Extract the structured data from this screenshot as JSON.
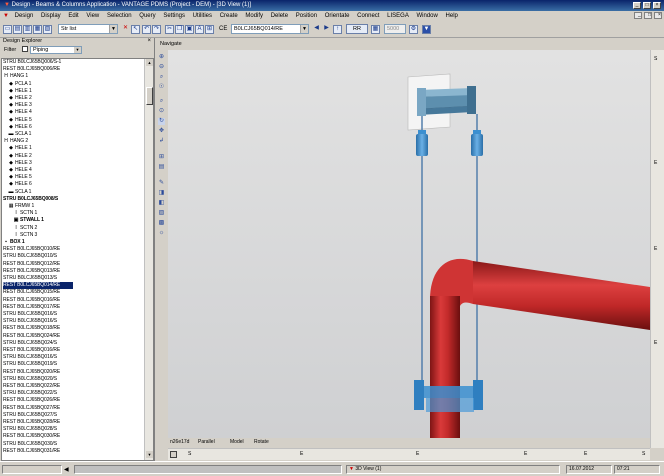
{
  "window": {
    "title": "Design - Beams & Columns Application - VANTAGE PDMS (Project - DEM) - [3D View (1)]"
  },
  "menu": {
    "items": [
      "Design",
      "Display",
      "Edit",
      "View",
      "Selection",
      "Query",
      "Settings",
      "Utilities",
      "Create",
      "Modify",
      "Delete",
      "Position",
      "Orientate",
      "Connect",
      "LISEGA",
      "Window",
      "Help"
    ]
  },
  "toolbar": {
    "element_field": "Str list",
    "ce_label": "CE",
    "ce_value": "B0LCJ65BQ014/RE",
    "rr_button": "RR",
    "zoom_field": "5000"
  },
  "explorer": {
    "title": "Design Explorer",
    "close_glyph": "×",
    "filter_label": "Filter",
    "filter_value": "Piping",
    "tree": [
      {
        "text": "STRU B0LCJ65BQ006/S-1",
        "icon": "",
        "indent": 0,
        "bold": false,
        "selected": false
      },
      {
        "text": "REST B0LCJ65BQ006/RE",
        "icon": "",
        "indent": 0,
        "bold": false,
        "selected": false
      },
      {
        "text": "HANG 1",
        "icon": "H",
        "indent": 0,
        "bold": false,
        "selected": false
      },
      {
        "text": "PCLA 1",
        "icon": "◆",
        "indent": 1,
        "bold": false,
        "selected": false
      },
      {
        "text": "HELE 1",
        "icon": "◆",
        "indent": 1,
        "bold": false,
        "selected": false
      },
      {
        "text": "HELE 2",
        "icon": "◆",
        "indent": 1,
        "bold": false,
        "selected": false
      },
      {
        "text": "HELE 3",
        "icon": "◆",
        "indent": 1,
        "bold": false,
        "selected": false
      },
      {
        "text": "HELE 4",
        "icon": "◆",
        "indent": 1,
        "bold": false,
        "selected": false
      },
      {
        "text": "HELE 5",
        "icon": "◆",
        "indent": 1,
        "bold": false,
        "selected": false
      },
      {
        "text": "HELE 6",
        "icon": "◆",
        "indent": 1,
        "bold": false,
        "selected": false
      },
      {
        "text": "SCLA 1",
        "icon": "▬",
        "indent": 1,
        "bold": false,
        "selected": false
      },
      {
        "text": "HANG 2",
        "icon": "H",
        "indent": 0,
        "bold": false,
        "selected": false
      },
      {
        "text": "HELE 1",
        "icon": "◆",
        "indent": 1,
        "bold": false,
        "selected": false
      },
      {
        "text": "HELE 2",
        "icon": "◆",
        "indent": 1,
        "bold": false,
        "selected": false
      },
      {
        "text": "HELE 3",
        "icon": "◆",
        "indent": 1,
        "bold": false,
        "selected": false
      },
      {
        "text": "HELE 4",
        "icon": "◆",
        "indent": 1,
        "bold": false,
        "selected": false
      },
      {
        "text": "HELE 5",
        "icon": "◆",
        "indent": 1,
        "bold": false,
        "selected": false
      },
      {
        "text": "HELE 6",
        "icon": "◆",
        "indent": 1,
        "bold": false,
        "selected": false
      },
      {
        "text": "SCLA 1",
        "icon": "▬",
        "indent": 1,
        "bold": false,
        "selected": false
      },
      {
        "text": "STRU B0LCJ65BQ008/S",
        "icon": "",
        "indent": 0,
        "bold": true,
        "selected": false
      },
      {
        "text": "FRMW 1",
        "icon": "▦",
        "indent": 1,
        "bold": false,
        "selected": false
      },
      {
        "text": "SCTN 1",
        "icon": "I",
        "indent": 2,
        "bold": false,
        "selected": false
      },
      {
        "text": "STWALL 1",
        "icon": "▣",
        "indent": 2,
        "bold": true,
        "selected": false
      },
      {
        "text": "SCTN 2",
        "icon": "I",
        "indent": 2,
        "bold": false,
        "selected": false
      },
      {
        "text": "SCTN 3",
        "icon": "I",
        "indent": 2,
        "bold": false,
        "selected": false
      },
      {
        "text": "BOX 1",
        "icon": "▪",
        "indent": 0,
        "bold": true,
        "selected": false
      },
      {
        "text": "REST B0LCJ65BQ010/RE",
        "icon": "",
        "indent": 0,
        "bold": false,
        "selected": false
      },
      {
        "text": "STRU B0LCJ65BQ010/S",
        "icon": "",
        "indent": 0,
        "bold": false,
        "selected": false
      },
      {
        "text": "REST B0LCJ65BQ012/RE",
        "icon": "",
        "indent": 0,
        "bold": false,
        "selected": false
      },
      {
        "text": "REST B0LCJ65BQ013/RE",
        "icon": "",
        "indent": 0,
        "bold": false,
        "selected": false
      },
      {
        "text": "STRU B0LCJ65BQ013/S",
        "icon": "",
        "indent": 0,
        "bold": false,
        "selected": false
      },
      {
        "text": "REST B0LCJ65BQ014/RE",
        "icon": "",
        "indent": 0,
        "bold": false,
        "selected": true
      },
      {
        "text": "REST B0LCJ65BQ015/RE",
        "icon": "",
        "indent": 0,
        "bold": false,
        "selected": false
      },
      {
        "text": "REST B0LCJ65BQ016/RE",
        "icon": "",
        "indent": 0,
        "bold": false,
        "selected": false
      },
      {
        "text": "REST B0LCJ65BQ017/RE",
        "icon": "",
        "indent": 0,
        "bold": false,
        "selected": false
      },
      {
        "text": "STRU B0LCJ65BQ016/S",
        "icon": "",
        "indent": 0,
        "bold": false,
        "selected": false
      },
      {
        "text": "STRU B0LCJ65BQ016/S",
        "icon": "",
        "indent": 0,
        "bold": false,
        "selected": false
      },
      {
        "text": "REST B0LCJ65BQ018/RE",
        "icon": "",
        "indent": 0,
        "bold": false,
        "selected": false
      },
      {
        "text": "REST B0LCJ65BQ024/RE",
        "icon": "",
        "indent": 0,
        "bold": false,
        "selected": false
      },
      {
        "text": "STRU B0LCJ65BQ024/S",
        "icon": "",
        "indent": 0,
        "bold": false,
        "selected": false
      },
      {
        "text": "REST B0LCJ65BQ016/RE",
        "icon": "",
        "indent": 0,
        "bold": false,
        "selected": false
      },
      {
        "text": "STRU B0LCJ65BQ016/S",
        "icon": "",
        "indent": 0,
        "bold": false,
        "selected": false
      },
      {
        "text": "STRU B0LCJ65BQ019/S",
        "icon": "",
        "indent": 0,
        "bold": false,
        "selected": false
      },
      {
        "text": "REST B0LCJ65BQ020/RE",
        "icon": "",
        "indent": 0,
        "bold": false,
        "selected": false
      },
      {
        "text": "STRU B0LCJ65BQ020/S",
        "icon": "",
        "indent": 0,
        "bold": false,
        "selected": false
      },
      {
        "text": "REST B0LCJ65BQ022/RE",
        "icon": "",
        "indent": 0,
        "bold": false,
        "selected": false
      },
      {
        "text": "STRU B0LCJ65BQ022/S",
        "icon": "",
        "indent": 0,
        "bold": false,
        "selected": false
      },
      {
        "text": "REST B0LCJ65BQ026/RE",
        "icon": "",
        "indent": 0,
        "bold": false,
        "selected": false
      },
      {
        "text": "REST B0LCJ65BQ027/RE",
        "icon": "",
        "indent": 0,
        "bold": false,
        "selected": false
      },
      {
        "text": "STRU B0LCJ65BQ027/S",
        "icon": "",
        "indent": 0,
        "bold": false,
        "selected": false
      },
      {
        "text": "REST B0LCJ65BQ028/RE",
        "icon": "",
        "indent": 0,
        "bold": false,
        "selected": false
      },
      {
        "text": "STRU B0LCJ65BQ028/S",
        "icon": "",
        "indent": 0,
        "bold": false,
        "selected": false
      },
      {
        "text": "REST B0LCJ65BQ030/RE",
        "icon": "",
        "indent": 0,
        "bold": false,
        "selected": false
      },
      {
        "text": "STRU B0LCJ65BQ030/S",
        "icon": "",
        "indent": 0,
        "bold": false,
        "selected": false
      },
      {
        "text": "REST B0LCJ65BQ031/RE",
        "icon": "",
        "indent": 0,
        "bold": false,
        "selected": false
      }
    ]
  },
  "view": {
    "tab_label": "Navigate",
    "status_items": [
      "n26e17d",
      "Parallel",
      "Model",
      "Rotate"
    ],
    "bottom_ticks": [
      "S",
      "E",
      "E",
      "E",
      "E",
      "S"
    ],
    "right_ticks": [
      "S",
      "E",
      "E",
      "E"
    ],
    "pipe_color": "#c22a2a",
    "support_color": "#3b8fd0"
  },
  "statusbar": {
    "task_label": "3D View (1)",
    "date": "16.07.2012",
    "time": "07:21"
  }
}
